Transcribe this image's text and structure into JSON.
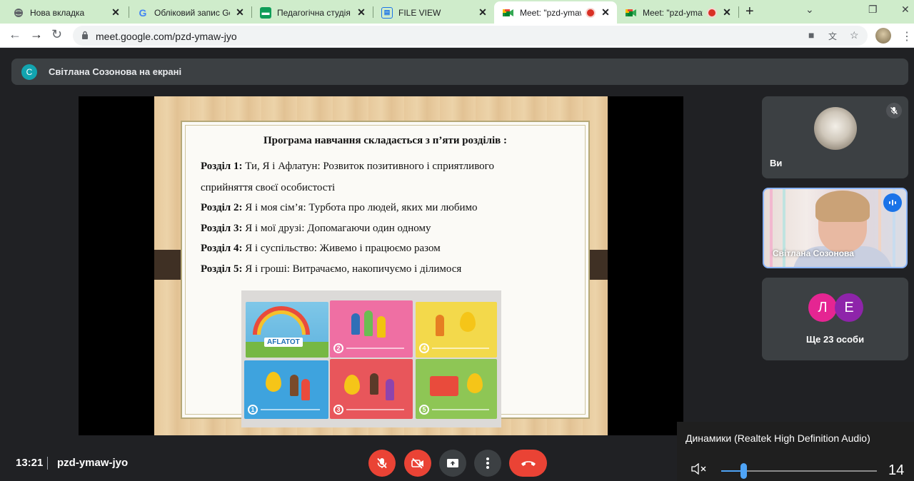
{
  "browser": {
    "tabs": [
      {
        "title": "Нова вкладка",
        "favicon": "globe-icon",
        "recording": false,
        "active": false
      },
      {
        "title": "Обліковий запис Goo",
        "favicon": "google-icon",
        "recording": false,
        "active": false
      },
      {
        "title": "Педагогічна студія (з",
        "favicon": "classroom-icon",
        "recording": false,
        "active": false
      },
      {
        "title": "FILE VIEW",
        "favicon": "document-icon",
        "recording": false,
        "active": false
      },
      {
        "title": "Meet: \"pzd-ymaw",
        "favicon": "meet-icon",
        "recording": true,
        "active": true
      },
      {
        "title": "Meet: \"pzd-ymaw",
        "favicon": "meet-icon",
        "recording": true,
        "active": false
      }
    ],
    "new_tab": "+",
    "url": "meet.google.com/pzd-ymaw-jyo",
    "colors": {
      "tab_strip": "#cfeccb",
      "active_tab": "#ffffff"
    }
  },
  "meet": {
    "presenter": {
      "initial": "С",
      "text": "Світлана Созонова на екрані"
    },
    "slide": {
      "title": "Програма навчання складається з п’яти розділів :",
      "sections": [
        {
          "label": "Розділ 1:",
          "text": "Ти, Я і Афлатун: Розвиток позитивного і сприятливого"
        },
        {
          "label": "",
          "text": "сприйняття своєї особистості"
        },
        {
          "label": "Розділ 2:",
          "text": "Я і моя сім’я: Турбота про людей, яких ми любимо"
        },
        {
          "label": "Розділ 3:",
          "text": "Я і мої друзі: Допомагаючи один одному"
        },
        {
          "label": "Розділ 4:",
          "text": "Я і суспільство: Живемо і працюємо разом"
        },
        {
          "label": "Розділ 5:",
          "text": "Я і гроші: Витрачаємо, накопичуємо і ділимося"
        }
      ],
      "book_logo": "AFLATOT",
      "book_numbers": [
        "1",
        "2",
        "3",
        "4",
        "5"
      ]
    },
    "participants": {
      "self": {
        "name": "Ви",
        "mic_muted": true
      },
      "speaker": {
        "name": "Світлана Созонова",
        "speaking": true
      },
      "others": {
        "initials": [
          "Л",
          "Е"
        ],
        "label": "Ще 23 особи",
        "colors": [
          "#e52592",
          "#8e24aa"
        ]
      }
    },
    "meeting": {
      "time": "13:21",
      "code": "pzd-ymaw-jyo"
    },
    "controls": [
      {
        "name": "mic",
        "icon": "mic-off-icon",
        "state": "off"
      },
      {
        "name": "camera",
        "icon": "camera-off-icon",
        "state": "off"
      },
      {
        "name": "present",
        "icon": "present-screen-icon"
      },
      {
        "name": "more",
        "icon": "more-vert-icon"
      },
      {
        "name": "leave",
        "icon": "hang-up-icon"
      }
    ],
    "colors": {
      "accent": "#8ab4f8",
      "danger": "#ea4335",
      "surface": "#3c4043",
      "background": "#202124",
      "presenter_badge": "#12a4af"
    }
  },
  "volume": {
    "device": "Динамики (Realtek High Definition Audio)",
    "speaker_icon": "speaker-muted-icon",
    "level": 14,
    "max": 100
  }
}
